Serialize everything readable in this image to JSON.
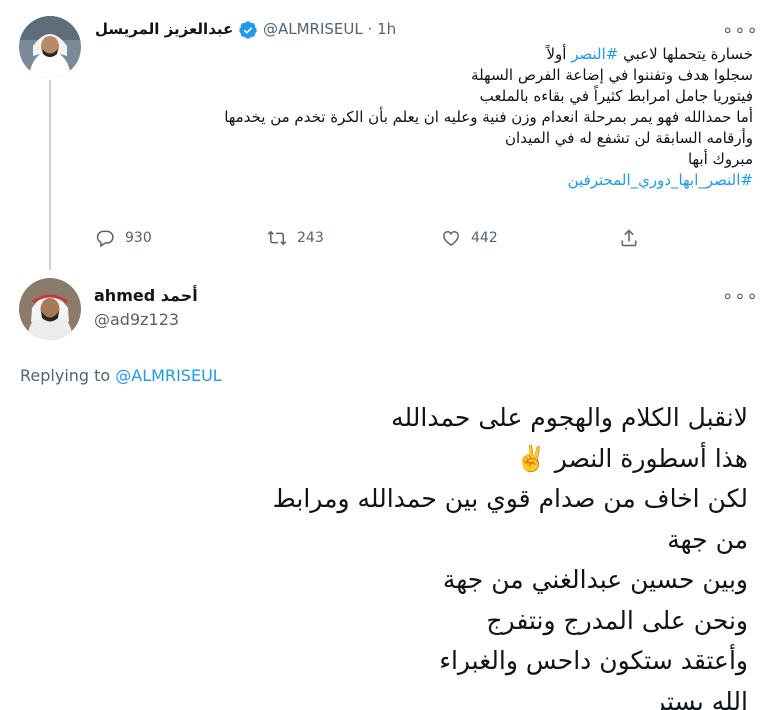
{
  "tweet1": {
    "display_name": "عبدالعزيز المريسل",
    "handle": "@ALMRISEUL",
    "time_sep": "·",
    "time": "1h",
    "verified_icon": "verified-badge-icon",
    "lines": [
      {
        "prefix": "خسارة يتحملها لاعبي ",
        "link": "#النصر",
        "suffix": " أولاً"
      },
      {
        "prefix": "سجلوا هدف وتفننوا في إضاعة الفرص السهلة",
        "link": "",
        "suffix": ""
      },
      {
        "prefix": "فيتوريا جامل امرابط كثيراً في بقاءه بالملعب",
        "link": "",
        "suffix": ""
      },
      {
        "prefix": "أما حمدالله فهو يمر بمرحلة انعدام وزن فنية وعليه ان يعلم بأن الكرة تخدم من يخدمها",
        "link": "",
        "suffix": ""
      },
      {
        "prefix": "وأرقامه السابقة لن تشفع له في الميدان",
        "link": "",
        "suffix": ""
      },
      {
        "prefix": "مبروك أبها",
        "link": "",
        "suffix": ""
      },
      {
        "prefix": "",
        "link": "#النصر_ابها_دوري_المحترفين",
        "suffix": ""
      }
    ],
    "replies": "930",
    "retweets": "243",
    "likes": "442"
  },
  "tweet2": {
    "display_name_ar": "أحمد",
    "display_name_en": "ahmed",
    "handle": "@ad9z123",
    "replying_prefix": "Replying to",
    "replying_to": "@ALMRISEUL",
    "lines": [
      "لانقبل الكلام والهجوم على حمدالله",
      "هذا أسطورة النصر ✌️",
      "لكن اخاف من صدام قوي بين حمدالله ومرابط",
      "من جهة",
      "وبين حسين عبدالغني من جهة",
      "ونحن على المدرج ونتفرج",
      "وأعتقد ستكون داحس والغبراء",
      "الله يستر"
    ]
  },
  "ui": {
    "more_glyph": "∘∘∘",
    "accent": "#1d9bf0",
    "muted": "#536471",
    "icons": [
      "reply-icon",
      "retweet-icon",
      "like-icon",
      "share-icon",
      "more-icon"
    ]
  }
}
